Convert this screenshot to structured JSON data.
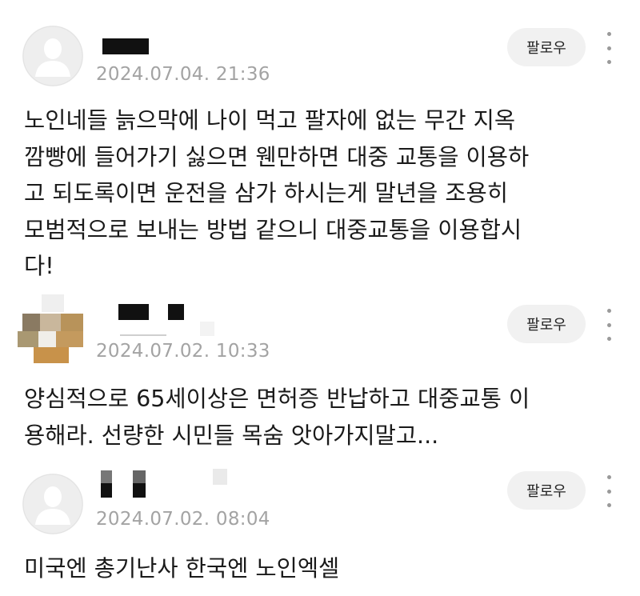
{
  "comments": [
    {
      "date": "2024.07.04. 21:36",
      "follow_label": "팔로우",
      "text": "노인네들 늙으막에 나이 먹고 팔자에 없는 무간 지옥\n깜빵에 들어가기 싫으면 웬만하면 대중 교통을 이용하\n고 되도록이면 운전을 삼가 하시는게 말년을 조용히\n모범적으로 보내는 방법 같으니 대중교통을 이용합시\n다!"
    },
    {
      "date": "2024.07.02. 10:33",
      "follow_label": "팔로우",
      "text": "양심적으로 65세이상은 면허증 반납하고 대중교통 이\n용해라. 선량한 시민들 목숨 앗아가지말고..."
    },
    {
      "date": "2024.07.02. 08:04",
      "follow_label": "팔로우",
      "text": "미국엔 총기난사 한국엔 노인엑셀"
    }
  ],
  "icons": {
    "avatar": "default-profile-icon",
    "more": "more-vertical-icon"
  }
}
